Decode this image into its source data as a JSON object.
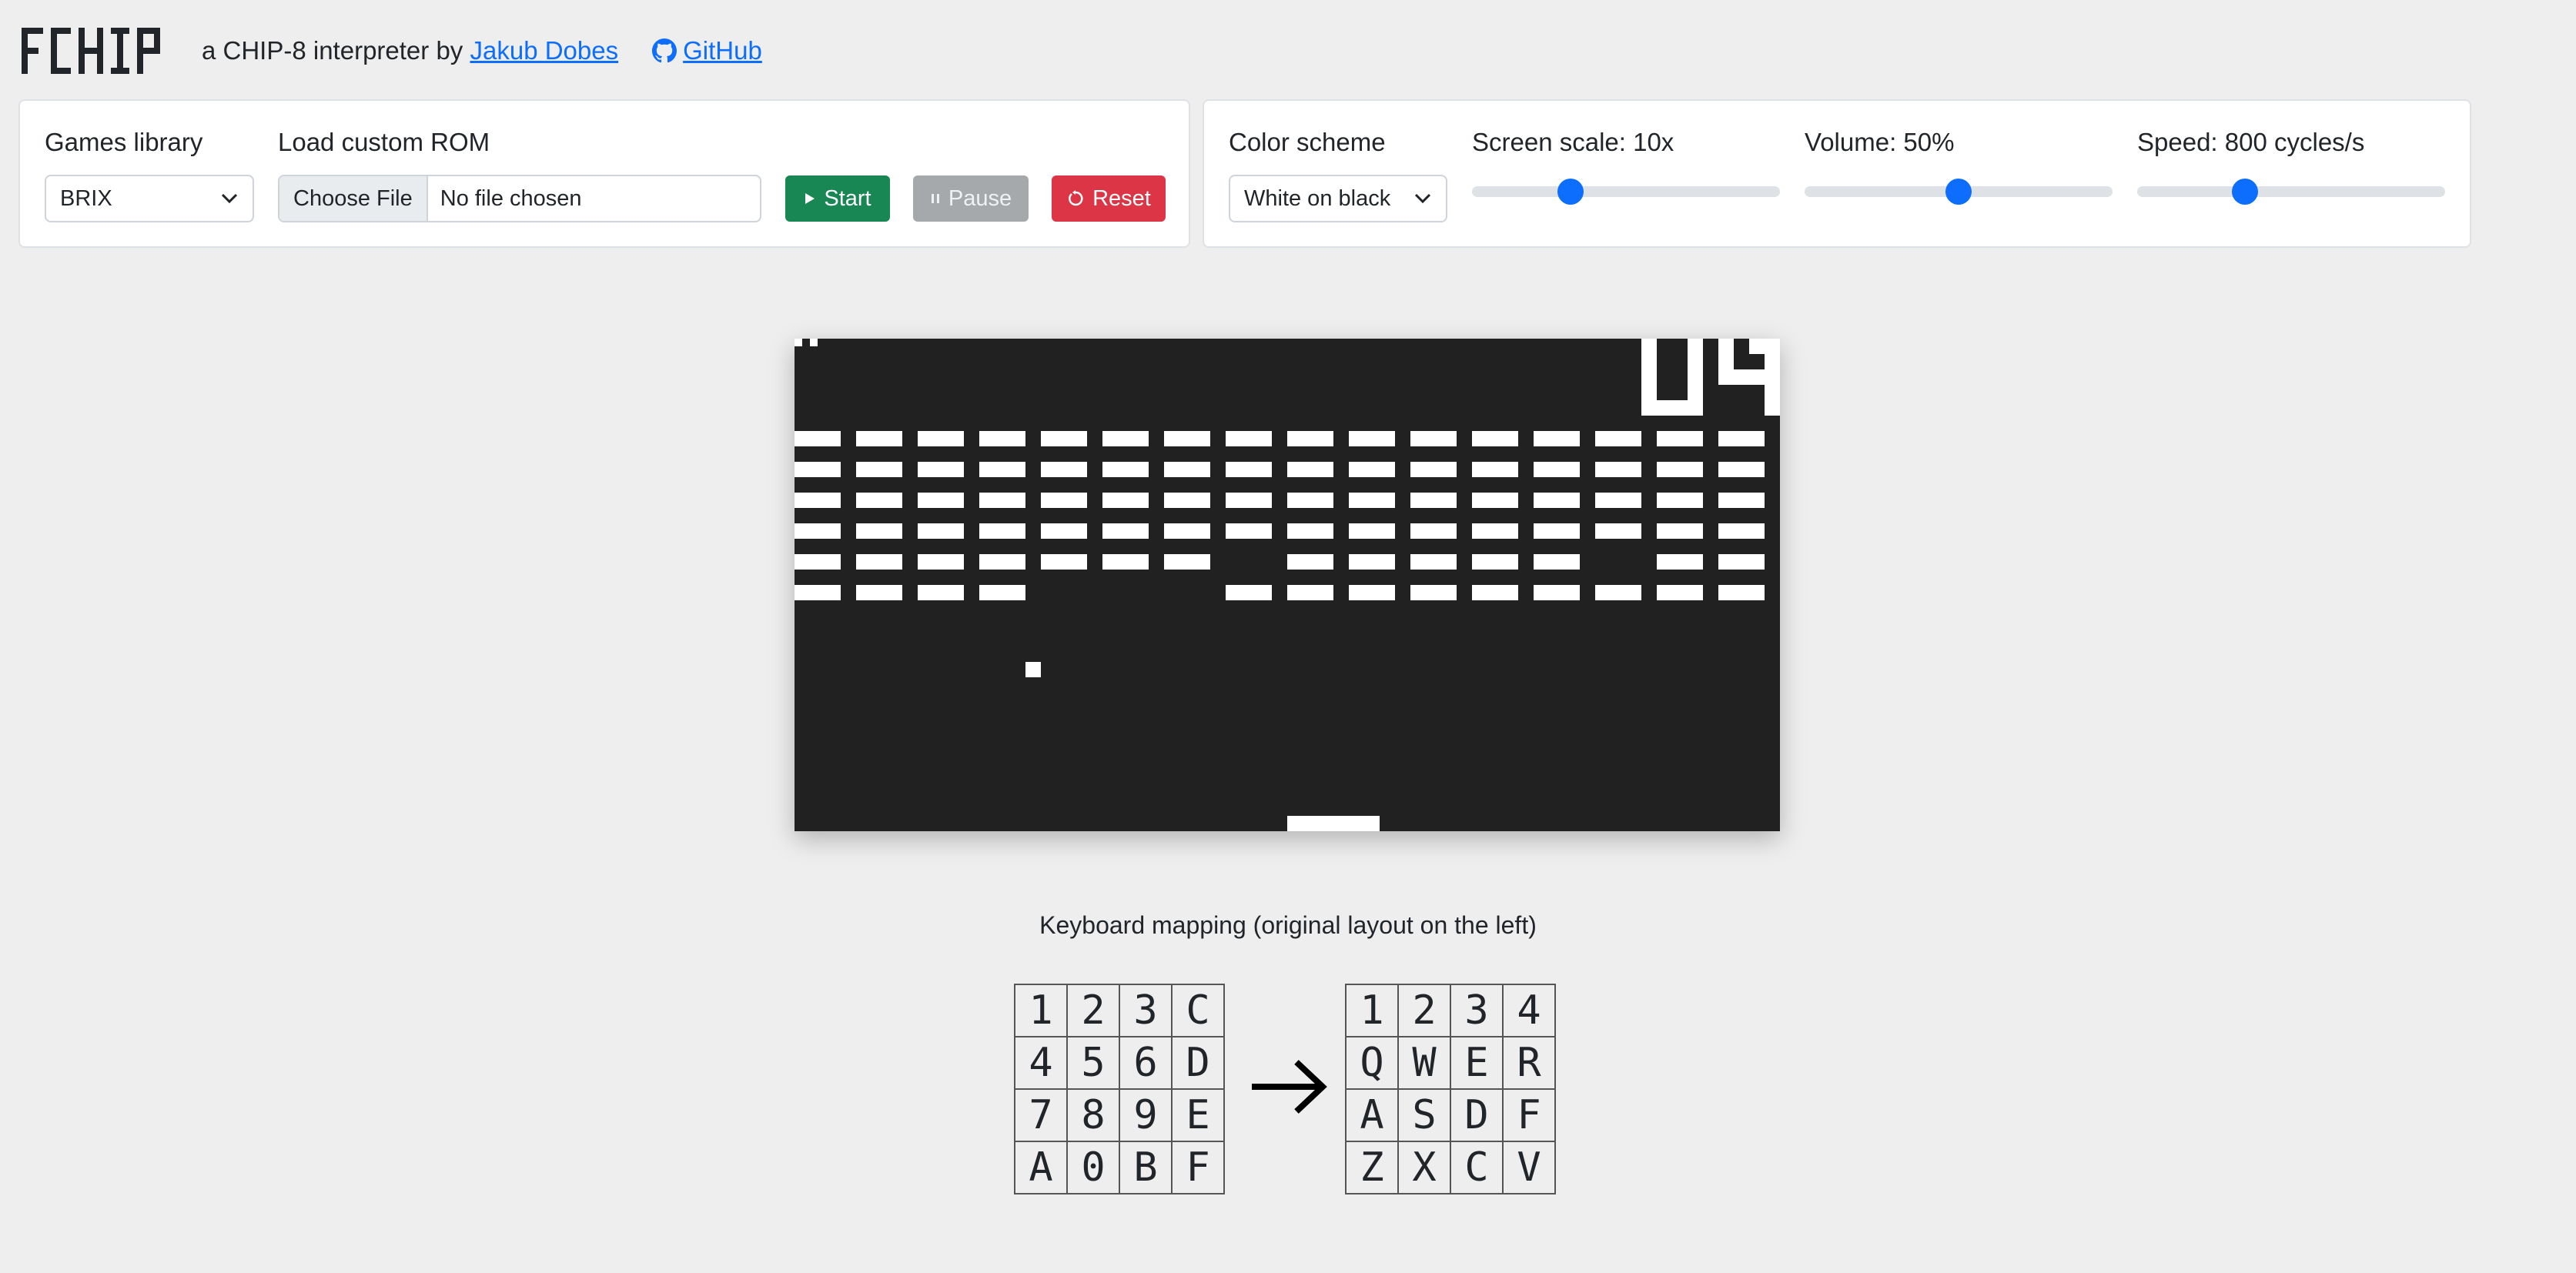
{
  "header": {
    "logo_text": "FCHIP",
    "tagline_prefix": "a CHIP-8 interpreter by",
    "author_link": "Jakub Dobes",
    "github_link": "GitHub"
  },
  "controls": {
    "games_library_label": "Games library",
    "games_library_value": "BRIX",
    "custom_rom_label": "Load custom ROM",
    "choose_file_label": "Choose File",
    "no_file_label": "No file chosen",
    "start_label": "Start",
    "pause_label": "Pause",
    "reset_label": "Reset",
    "color_scheme_label": "Color scheme",
    "color_scheme_value": "White on black",
    "screen_scale_label": "Screen scale: 10x",
    "screen_scale_fraction": 0.32,
    "volume_label": "Volume: 50%",
    "volume_fraction": 0.5,
    "speed_label": "Speed: 800 cycles/s",
    "speed_fraction": 0.35
  },
  "colors": {
    "accent": "#0d6efd",
    "start": "#198754",
    "pause": "#a6a9ac",
    "reset": "#dc3545",
    "screen_bg": "#212121",
    "screen_fg": "#ffffff"
  },
  "game_screen": {
    "score": "04",
    "brick_rows": [
      [
        1,
        1,
        1,
        1,
        1,
        1,
        1,
        1,
        1,
        1,
        1,
        1,
        1,
        1,
        1,
        1
      ],
      [
        1,
        1,
        1,
        1,
        1,
        1,
        1,
        1,
        1,
        1,
        1,
        1,
        1,
        1,
        1,
        1
      ],
      [
        1,
        1,
        1,
        1,
        1,
        1,
        1,
        1,
        1,
        1,
        1,
        1,
        1,
        1,
        1,
        1
      ],
      [
        1,
        1,
        1,
        1,
        1,
        1,
        1,
        1,
        1,
        1,
        1,
        1,
        1,
        1,
        1,
        1
      ],
      [
        1,
        1,
        1,
        1,
        1,
        1,
        1,
        0,
        1,
        1,
        1,
        1,
        1,
        0,
        1,
        1
      ],
      [
        1,
        1,
        1,
        1,
        0,
        0,
        0,
        1,
        1,
        1,
        1,
        1,
        1,
        1,
        1,
        1
      ]
    ]
  },
  "keyboard": {
    "title": "Keyboard mapping (original layout on the left)",
    "original": [
      [
        "1",
        "2",
        "3",
        "C"
      ],
      [
        "4",
        "5",
        "6",
        "D"
      ],
      [
        "7",
        "8",
        "9",
        "E"
      ],
      [
        "A",
        "0",
        "B",
        "F"
      ]
    ],
    "mapped": [
      [
        "1",
        "2",
        "3",
        "4"
      ],
      [
        "Q",
        "W",
        "E",
        "R"
      ],
      [
        "A",
        "S",
        "D",
        "F"
      ],
      [
        "Z",
        "X",
        "C",
        "V"
      ]
    ],
    "arrow_icon": "arrow-right-icon"
  }
}
